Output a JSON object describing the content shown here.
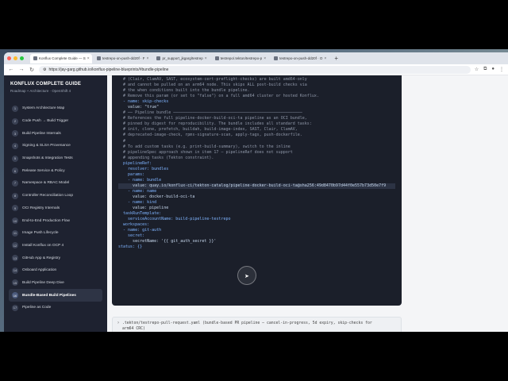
{
  "browser": {
    "tabs": [
      {
        "title": "Konflux Complete Guide — S",
        "active": true
      },
      {
        "title": "testrepo-on-push-dd20f · F"
      },
      {
        "title": "pr_support_jkgarg/testrep"
      },
      {
        "title": "testrepo/.tekton/testrepo-p"
      },
      {
        "title": "testrepo-on-push-dd20f · O"
      }
    ],
    "new_tab": "+",
    "url": "https://jay-garg.github.io/konflux-pipeline-blueprints/#bundle-pipeline"
  },
  "sidebar": {
    "title": "KONFLUX COMPLETE GUIDE",
    "subtitle": "Roadmap + Architecture · OpenShift 4",
    "items": [
      {
        "num": "1",
        "label": "System Architecture Map"
      },
      {
        "num": "2",
        "label": "Code Push → Build Trigger"
      },
      {
        "num": "3",
        "label": "Build Pipeline Internals"
      },
      {
        "num": "4",
        "label": "Signing & SLSA Provenance"
      },
      {
        "num": "5",
        "label": "Snapshots & Integration Tests"
      },
      {
        "num": "6",
        "label": "Release Service & Policy"
      },
      {
        "num": "7",
        "label": "Namespace & RBAC Model"
      },
      {
        "num": "8",
        "label": "Controller Reconciliation Loop"
      },
      {
        "num": "9",
        "label": "OCI Registry Internals"
      },
      {
        "num": "10",
        "label": "End-to-End Production Flow"
      },
      {
        "num": "11",
        "label": "Image Push Lifecycle"
      },
      {
        "num": "12",
        "label": "Install Konflux on OCP 4"
      },
      {
        "num": "13",
        "label": "GitHub App & Registry"
      },
      {
        "num": "14",
        "label": "Onboard Application"
      },
      {
        "num": "15",
        "label": "Build Pipeline Deep Dive"
      },
      {
        "num": "16",
        "label": "Bundle-Based Build Pipelines",
        "active": true
      },
      {
        "num": "17",
        "label": "Pipeline as Code"
      }
    ]
  },
  "code": {
    "lines": [
      {
        "t": "  # (Clair, ClamAV, SAST, ecosystem-cert-preflight-checks) are built amd64-only",
        "k": "com"
      },
      {
        "t": "  # and cannot be pulled on an arm64 node. This skips ALL post-build checks via",
        "k": "com"
      },
      {
        "t": "  # the when conditions built into the bundle pipeline.",
        "k": "com"
      },
      {
        "t": "  # Remove this param (or set to \"false\") on a full amd64 cluster or hosted Konflux.",
        "k": "com"
      },
      {
        "t": "  - name: skip-checks",
        "k": "key"
      },
      {
        "t": "    value: \"true\"",
        "k": "str"
      },
      {
        "t": "",
        "k": "str"
      },
      {
        "t": "  # ── Pipeline bundle ──────────────────────────────────────────────────────",
        "k": "com"
      },
      {
        "t": "  # References the full pipeline-docker-build-oci-ta pipeline as an OCI bundle,",
        "k": "com"
      },
      {
        "t": "  # pinned by digest for reproducibility. The bundle includes all standard tasks:",
        "k": "com"
      },
      {
        "t": "  # init, clone, prefetch, buildah, build-image-index, SAST, Clair, ClamAV,",
        "k": "com"
      },
      {
        "t": "  # deprecated-image-check, rpms-signature-scan, apply-tags, push-dockerfile.",
        "k": "com"
      },
      {
        "t": "  #",
        "k": "com"
      },
      {
        "t": "  # To add custom tasks (e.g. print-build-summary), switch to the inline",
        "k": "com"
      },
      {
        "t": "  # pipelineSpec approach shown in item 17 — pipelineRef does not support",
        "k": "com"
      },
      {
        "t": "  # appending tasks (Tekton constraint).",
        "k": "com"
      },
      {
        "t": "  pipelineRef:",
        "k": "key"
      },
      {
        "t": "    resolver: bundles",
        "k": "key"
      },
      {
        "t": "    params:",
        "k": "key"
      },
      {
        "t": "    - name: bundle",
        "k": "key"
      },
      {
        "t": "      value: quay.io/konflux-ci/tekton-catalog/pipeline-docker-build-oci-ta@sha256:49d8470b97d44f0e557b73d50e7f9",
        "k": "str",
        "hl": true
      },
      {
        "t": "    - name: name",
        "k": "key"
      },
      {
        "t": "      value: docker-build-oci-ta",
        "k": "str"
      },
      {
        "t": "    - name: kind",
        "k": "key"
      },
      {
        "t": "      value: pipeline",
        "k": "str"
      },
      {
        "t": "",
        "k": "str"
      },
      {
        "t": "  taskRunTemplate:",
        "k": "key"
      },
      {
        "t": "    serviceAccountName: build-pipeline-testrepo",
        "k": "key"
      },
      {
        "t": "  workspaces:",
        "k": "key"
      },
      {
        "t": "  - name: git-auth",
        "k": "key"
      },
      {
        "t": "    secret:",
        "k": "key"
      },
      {
        "t": "      secretName: '{{ git_auth_secret }}'",
        "k": "str"
      },
      {
        "t": "status: {}",
        "k": "key"
      }
    ]
  },
  "file_bar": {
    "line1": ".tekton/testrepo-pull-request.yaml (bundle-based PR pipeline — cancel-in-progress, 5d expiry, skip-checks for",
    "line2": "arm64 CRC)"
  },
  "colors": {
    "sidebar_bg": "#1e2230",
    "code_bg": "#1b1f2a",
    "accent": "#7fb4ff"
  }
}
